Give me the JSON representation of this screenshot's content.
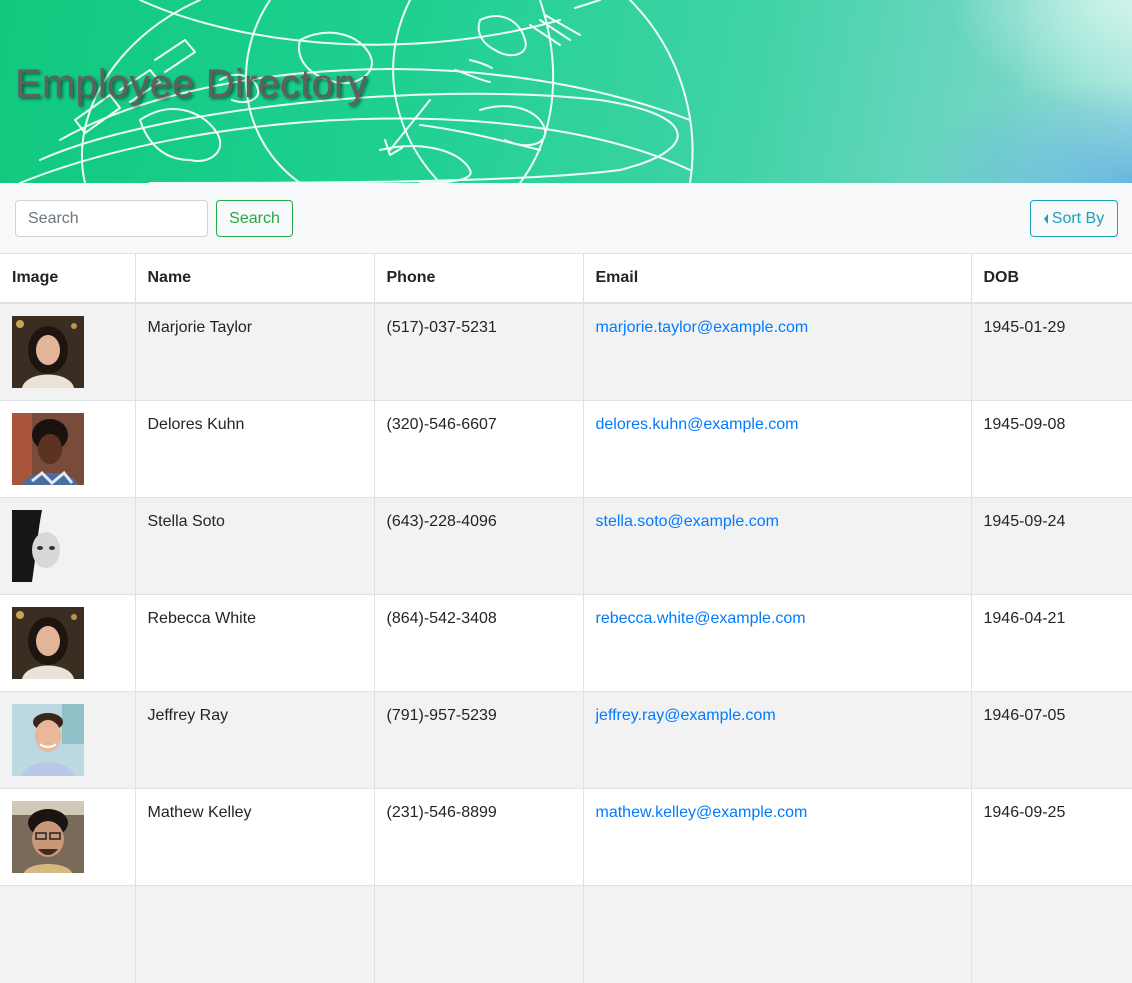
{
  "header": {
    "title": "Employee Directory"
  },
  "toolbar": {
    "search_placeholder": "Search",
    "search_button_label": "Search",
    "sort_button_label": "Sort By"
  },
  "table": {
    "columns": [
      "Image",
      "Name",
      "Phone",
      "Email",
      "DOB"
    ],
    "rows": [
      {
        "name": "Marjorie Taylor",
        "phone": "(517)-037-5231",
        "email": "marjorie.taylor@example.com",
        "dob": "1945-01-29"
      },
      {
        "name": "Delores Kuhn",
        "phone": "(320)-546-6607",
        "email": "delores.kuhn@example.com",
        "dob": "1945-09-08"
      },
      {
        "name": "Stella Soto",
        "phone": "(643)-228-4096",
        "email": "stella.soto@example.com",
        "dob": "1945-09-24"
      },
      {
        "name": "Rebecca White",
        "phone": "(864)-542-3408",
        "email": "rebecca.white@example.com",
        "dob": "1946-04-21"
      },
      {
        "name": "Jeffrey Ray",
        "phone": "(791)-957-5239",
        "email": "jeffrey.ray@example.com",
        "dob": "1946-07-05"
      },
      {
        "name": "Mathew Kelley",
        "phone": "(231)-546-8899",
        "email": "mathew.kelley@example.com",
        "dob": "1946-09-25"
      },
      {
        "name": "",
        "phone": "",
        "email": "",
        "dob": ""
      }
    ]
  },
  "colors": {
    "search_green": "#28a745",
    "sort_teal": "#17a2b8",
    "link_blue": "#007bff",
    "stripe_gray": "#f2f2f2"
  },
  "icons": {
    "sort_button": "caret-left-icon"
  }
}
